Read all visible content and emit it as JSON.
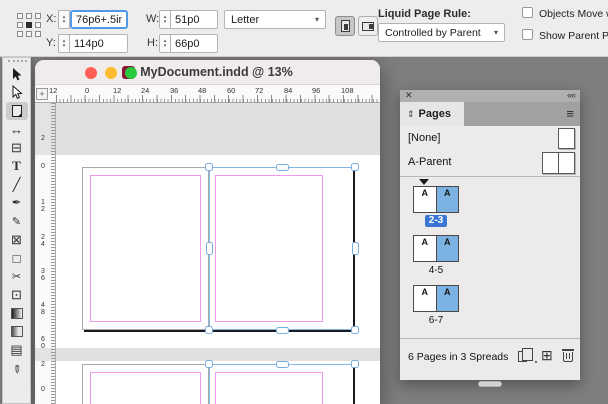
{
  "controls": {
    "x": {
      "label": "X:",
      "value": "76p6+.5in"
    },
    "y": {
      "label": "Y:",
      "value": "114p0"
    },
    "w": {
      "label": "W:",
      "value": "51p0"
    },
    "h": {
      "label": "H:",
      "value": "66p0"
    },
    "page_size": {
      "value": "Letter"
    },
    "liquid_rule": {
      "label": "Liquid Page Rule:",
      "value": "Controlled by Parent"
    },
    "checkboxes": [
      {
        "label": "Objects Move with P",
        "checked": false
      },
      {
        "label": "Show Parent Page Ov",
        "checked": false
      }
    ],
    "orientation": {
      "selected": "portrait"
    }
  },
  "window": {
    "title": "MyDocument.indd @ 13%",
    "app_icon_text": "Id",
    "zoom_level": "13%"
  },
  "h_ruler": [
    "12",
    "0",
    "12",
    "24",
    "36",
    "48",
    "60",
    "72",
    "84",
    "96",
    "108"
  ],
  "v_ruler": [
    "2",
    "0",
    "12",
    "24",
    "36",
    "48",
    "60",
    "2",
    "0"
  ],
  "toolbar": {
    "tools": [
      {
        "name": "selection-tool",
        "glyph": ""
      },
      {
        "name": "direct-selection-tool",
        "glyph": ""
      },
      {
        "name": "page-tool",
        "glyph": "",
        "selected": true
      },
      {
        "name": "gap-tool",
        "glyph": "↔"
      },
      {
        "name": "content-collector-tool",
        "glyph": "⊟"
      },
      {
        "name": "type-tool",
        "glyph": "T"
      },
      {
        "name": "line-tool",
        "glyph": "╱"
      },
      {
        "name": "pen-tool",
        "glyph": "✒"
      },
      {
        "name": "pencil-tool",
        "glyph": "✎"
      },
      {
        "name": "rectangle-frame-tool",
        "glyph": "⊠"
      },
      {
        "name": "rectangle-tool",
        "glyph": "□"
      },
      {
        "name": "scissors-tool",
        "glyph": "✂"
      },
      {
        "name": "free-transform-tool",
        "glyph": "⊡"
      },
      {
        "name": "gradient-swatch-tool",
        "glyph": ""
      },
      {
        "name": "gradient-feather-tool",
        "glyph": ""
      },
      {
        "name": "note-tool",
        "glyph": "▤"
      },
      {
        "name": "eyedropper-tool",
        "glyph": "✐"
      }
    ]
  },
  "pages_panel": {
    "tab_label": "Pages",
    "parents": [
      {
        "label": "[None]"
      },
      {
        "label": "A-Parent"
      }
    ],
    "spreads": [
      {
        "label": "2-3",
        "selected": true,
        "left_letter": "A",
        "right_letter": "A"
      },
      {
        "label": "4-5",
        "selected": false,
        "left_letter": "A",
        "right_letter": "A"
      },
      {
        "label": "6-7",
        "selected": false,
        "left_letter": "A",
        "right_letter": "A"
      }
    ],
    "status": "6 Pages in 3 Spreads"
  },
  "icons": {
    "stepper_up": "▴",
    "stepper_down": "▾",
    "chevron_down": "▾",
    "close": "✕",
    "collapse": "««",
    "menu": "≡",
    "panel_toggle": "⇕",
    "new_page": "⊞",
    "ruler_origin": "+"
  },
  "colors": {
    "accent_blue": "#3a76d3",
    "selection_blue": "#85b8e6",
    "margin_guide_pink": "#f09aec",
    "thumbnail_blue": "#7cb2e1",
    "traffic_red": "#ff5f57",
    "traffic_yellow": "#febc2e",
    "traffic_green": "#28c840"
  }
}
